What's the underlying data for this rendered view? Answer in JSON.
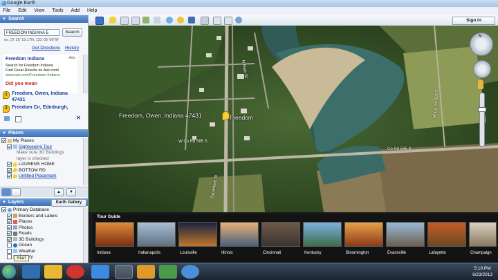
{
  "window": {
    "title": "Google Earth"
  },
  "menu": [
    "File",
    "Edit",
    "View",
    "Tools",
    "Add",
    "Help"
  ],
  "search": {
    "header": "Search",
    "query": "FREEDOM INDIANA E",
    "button": "Search",
    "coords": "ex: 37 25' 19.17N, 122 05' 06\"W",
    "get_directions": "Get Directions",
    "history": "History",
    "ad_title": "Freedom Indiana",
    "ad_badge": "Ads",
    "ad_line1": "Search for Freedom Indiana",
    "ad_line2": "Find Great Results on Ask.com!",
    "ad_url": "www.ask.com/Freedom+Indiana",
    "did_you_mean": "Did you mean",
    "results": [
      {
        "marker": "1",
        "text": "Freedom, Owen, Indiana 47431"
      },
      {
        "marker": "2",
        "text": "Freedom Cir, Edinburgh,"
      }
    ]
  },
  "places": {
    "header": "Places",
    "items": [
      {
        "label": "My Places",
        "link": false
      },
      {
        "label": "Sightseeing Tour",
        "link": true
      },
      {
        "label": "Make sure 3D Buildings",
        "link": false
      },
      {
        "label": "layer is checked",
        "link": false
      },
      {
        "label": "LAURENS HOME",
        "link": false
      },
      {
        "label": "BOTTOM RD",
        "link": false
      },
      {
        "label": "Untitled Placemark",
        "link": true
      }
    ]
  },
  "layers": {
    "header": "Layers",
    "gallery_button": "Earth Gallery",
    "items": [
      "Primary Database",
      "Borders and Labels",
      "Places",
      "Photos",
      "Roads",
      "3D Buildings",
      "Ocean",
      "Weather",
      "Gallery"
    ]
  },
  "toolbar": {
    "sign_in": "Sign in"
  },
  "map": {
    "place_label": "Freedom, Owen, Indiana 47431",
    "pin_label": "Freedom",
    "roads": [
      "W Co Rd 585 S",
      "Co Rd 585 S",
      "N Main St",
      "W Co Rd 585 S",
      "Sycamore St"
    ]
  },
  "tour": {
    "header": "Tour Guide",
    "items": [
      "Indiana",
      "Indianapolis",
      "Louisville",
      "Illinois",
      "Cincinnati",
      "Kentucky",
      "Bloomington",
      "Evansville",
      "Lafayette",
      "Champaign"
    ]
  },
  "taskbar": {
    "start_tooltip": "Start",
    "time": "5:10 PM",
    "date": "6/23/2013"
  }
}
